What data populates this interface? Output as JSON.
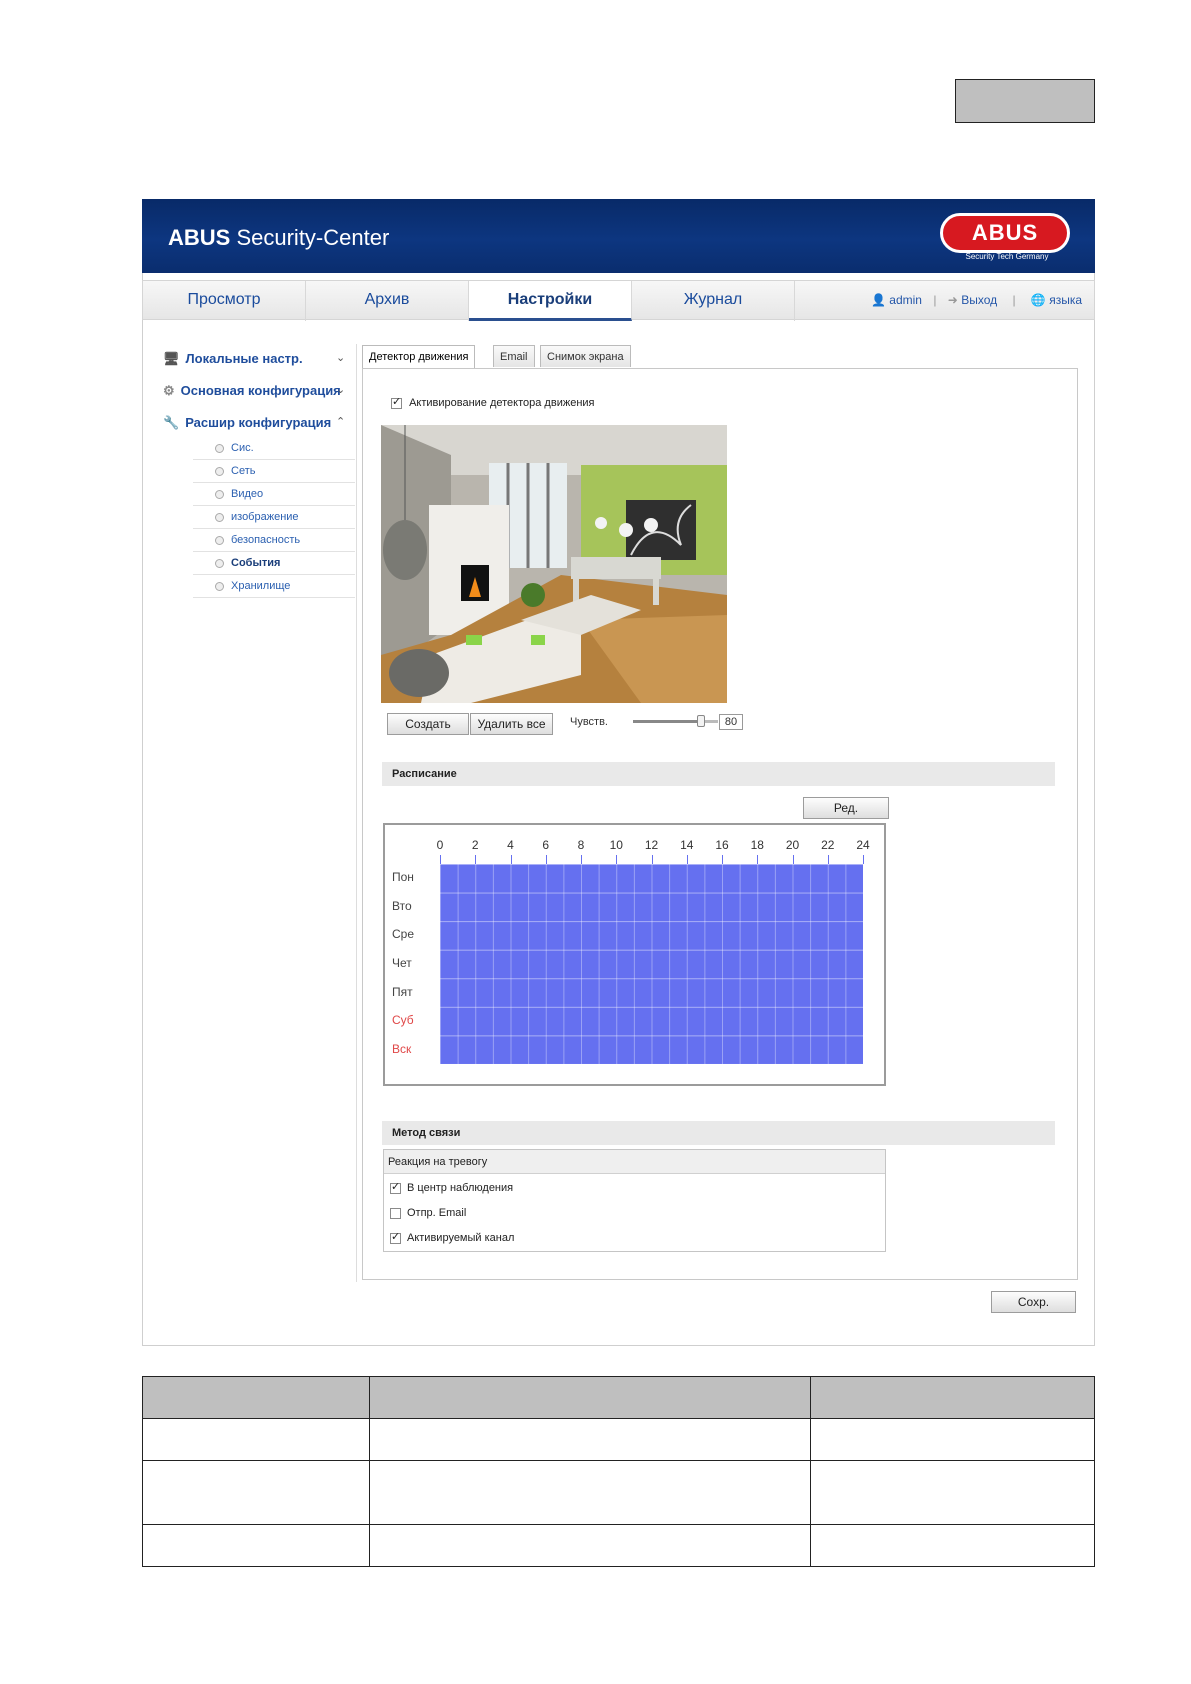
{
  "header": {
    "title_bold": "ABUS",
    "title_rest": " Security-Center",
    "logo": "ABUS",
    "logo_tagline": "Security Tech Germany"
  },
  "nav": {
    "tabs": [
      {
        "label": "Просмотр"
      },
      {
        "label": "Архив"
      },
      {
        "label": "Настройки"
      },
      {
        "label": "Журнал"
      }
    ],
    "active_tab": "Настройки",
    "user": "admin",
    "logout": "Выход",
    "language": "языка"
  },
  "sidebar": {
    "items": [
      {
        "label": "Локальные настр.",
        "icon": "monitor-icon",
        "expander": "chevron-down-icon"
      },
      {
        "label": "Основная конфигурация",
        "icon": "gear-icon",
        "expander": "chevron-down-icon"
      },
      {
        "label": "Расшир конфигурация",
        "icon": "wrench-icon",
        "expander": "chevron-up-icon"
      }
    ],
    "subitems": [
      {
        "label": "Сис."
      },
      {
        "label": "Сеть"
      },
      {
        "label": "Видео"
      },
      {
        "label": "изображение"
      },
      {
        "label": "безопасность"
      },
      {
        "label": "События"
      },
      {
        "label": "Хранилище"
      }
    ],
    "active_subitem": "События"
  },
  "tabs": {
    "items": [
      {
        "label": "Детектор движения"
      },
      {
        "label": "Email"
      },
      {
        "label": "Снимок экрана"
      }
    ],
    "active": "Детектор движения"
  },
  "motion": {
    "enable_label": "Активирование детектора движения",
    "enable_checked": true,
    "create_button": "Создать",
    "delete_all_button": "Удалить все",
    "sensitivity_label": "Чувств.",
    "sensitivity_value": "80",
    "sensitivity_fraction": 0.8
  },
  "schedule": {
    "section_title": "Расписание",
    "edit_button": "Ред.",
    "hour_ticks": [
      "0",
      "2",
      "4",
      "6",
      "8",
      "10",
      "12",
      "14",
      "16",
      "18",
      "20",
      "22",
      "24"
    ],
    "days": [
      {
        "label": "Пон",
        "weekend": false
      },
      {
        "label": "Вто",
        "weekend": false
      },
      {
        "label": "Сре",
        "weekend": false
      },
      {
        "label": "Чет",
        "weekend": false
      },
      {
        "label": "Пят",
        "weekend": false
      },
      {
        "label": "Суб",
        "weekend": true
      },
      {
        "label": "Вск",
        "weekend": true
      }
    ],
    "fill_color": "#6570f0"
  },
  "linkage": {
    "section_title": "Метод связи",
    "group_title": "Реакция на тревогу",
    "options": [
      {
        "label": "В центр наблюдения",
        "checked": true
      },
      {
        "label": "Отпр. Email",
        "checked": false
      },
      {
        "label": "Активируемый канал",
        "checked": true
      }
    ]
  },
  "save_button": "Сохр.",
  "colors": {
    "header_bg": "#0b3175",
    "logo_red": "#d71920",
    "link_blue": "#1f4d9c",
    "weekend_red": "#e04848"
  }
}
